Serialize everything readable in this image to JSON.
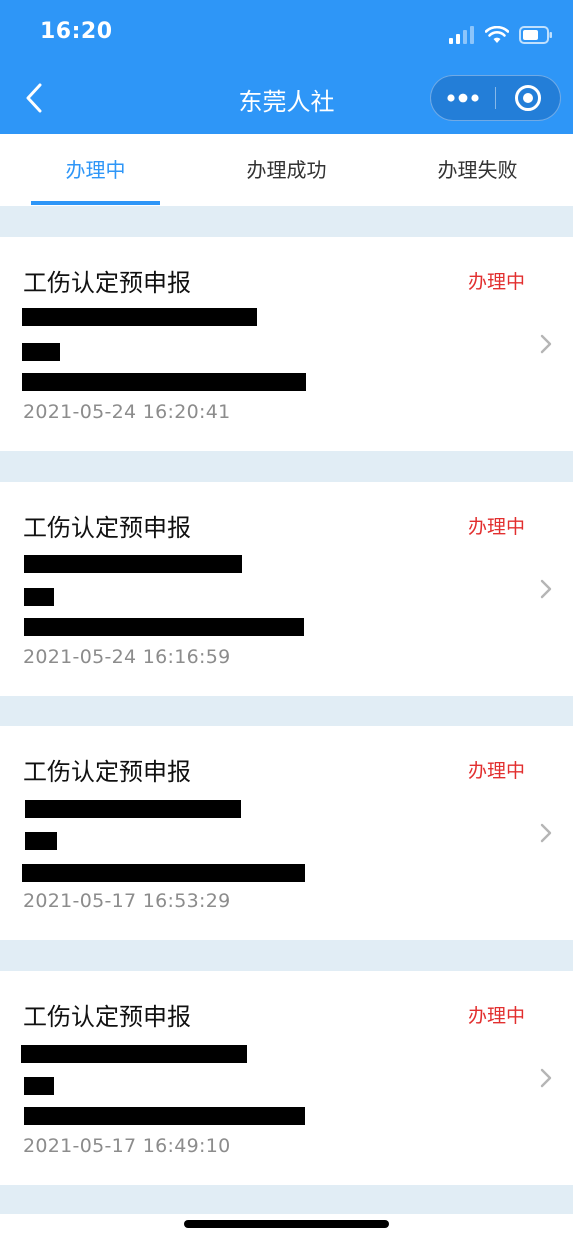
{
  "status_bar": {
    "time": "16:20",
    "icons": [
      "cellular-signal-icon",
      "wifi-icon",
      "battery-icon"
    ]
  },
  "nav": {
    "title": "东莞人社",
    "back_icon": "chevron-left-icon",
    "more_icon": "more-dots-icon",
    "close_icon": "target-circle-icon"
  },
  "tabs": [
    {
      "label": "办理中",
      "active": true
    },
    {
      "label": "办理成功",
      "active": false
    },
    {
      "label": "办理失败",
      "active": false
    }
  ],
  "records": [
    {
      "title": "工伤认定预申报",
      "status": "办理中",
      "time": "2021-05-24 16:20:41"
    },
    {
      "title": "工伤认定预申报",
      "status": "办理中",
      "time": "2021-05-24 16:16:59"
    },
    {
      "title": "工伤认定预申报",
      "status": "办理中",
      "time": "2021-05-17 16:53:29"
    },
    {
      "title": "工伤认定预申报",
      "status": "办理中",
      "time": "2021-05-17 16:49:10"
    }
  ],
  "colors": {
    "header_blue": "#2e96f7",
    "status_red": "#e22f2f",
    "page_bg": "#e1edf5"
  }
}
